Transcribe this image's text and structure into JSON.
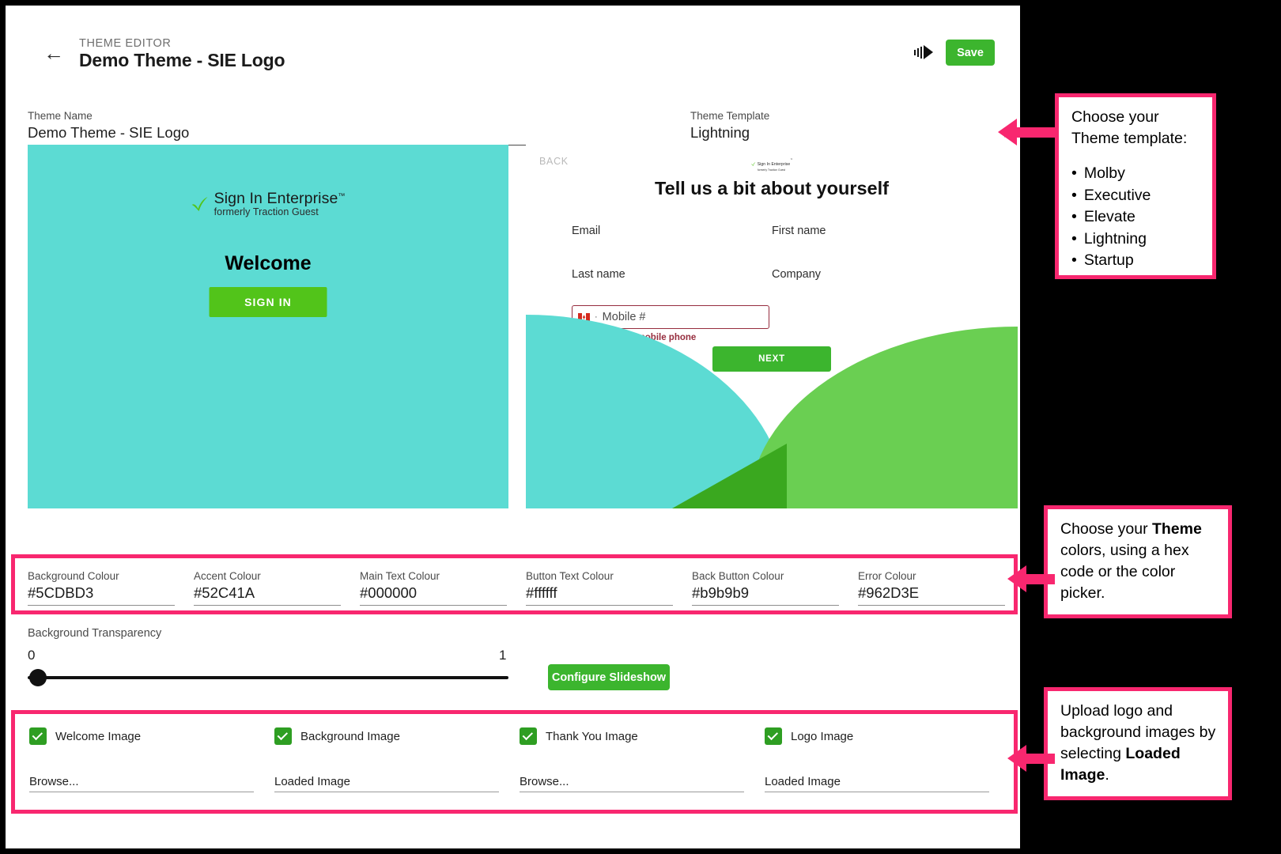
{
  "header": {
    "eyebrow": "THEME EDITOR",
    "title": "Demo Theme - SIE Logo",
    "back_icon": "arrow-left-icon",
    "step_icon": "skip-forward-icon",
    "save_label": "Save",
    "save_color": "#3cb52e"
  },
  "fields": {
    "theme_name": {
      "label": "Theme Name",
      "value": "Demo Theme - SIE Logo"
    },
    "theme_template": {
      "label": "Theme Template",
      "value": "Lightning",
      "options": [
        "Molby",
        "Executive",
        "Elevate",
        "Lightning",
        "Startup"
      ]
    }
  },
  "preview_left": {
    "background_color": "#5CDBD3",
    "logo_name": "Sign In Enterprise",
    "logo_tm": "™",
    "logo_sub": "formerly Traction Guest",
    "welcome": "Welcome",
    "signin_label": "SIGN IN",
    "signin_color": "#52C41A"
  },
  "preview_right": {
    "back_label": "BACK",
    "logo_name": "Sign In Enterprise",
    "logo_tm": "™",
    "logo_sub": "formerly Traction Guest",
    "title": "Tell us a bit about yourself",
    "labels": [
      "Email",
      "First name",
      "Last name",
      "Company"
    ],
    "mobile_placeholder": "Mobile #",
    "mobile_country": "CA",
    "mobile_sep": "·",
    "error_text": "Please enter a mobile phone",
    "next_label": "NEXT",
    "wave_teal": "#5CDBD3",
    "wave_green": "#6ACF52",
    "wave_overlap": "#3aa81f"
  },
  "colours": [
    {
      "label": "Background Colour",
      "value": "#5CDBD3"
    },
    {
      "label": "Accent Colour",
      "value": "#52C41A"
    },
    {
      "label": "Main Text Colour",
      "value": "#000000"
    },
    {
      "label": "Button Text Colour",
      "value": "#ffffff"
    },
    {
      "label": "Back Button Colour",
      "value": "#b9b9b9"
    },
    {
      "label": "Error Colour",
      "value": "#962D3E"
    }
  ],
  "transparency": {
    "label": "Background Transparency",
    "min": "0",
    "max": "1",
    "value": 0,
    "slideshow_label": "Configure Slideshow"
  },
  "images": [
    {
      "checkbox_label": "Welcome Image",
      "checked": true,
      "file_value": "Browse..."
    },
    {
      "checkbox_label": "Background Image",
      "checked": true,
      "file_value": "Loaded Image"
    },
    {
      "checkbox_label": "Thank You Image",
      "checked": true,
      "file_value": "Browse..."
    },
    {
      "checkbox_label": "Logo Image",
      "checked": true,
      "file_value": "Loaded Image"
    }
  ],
  "annotations": {
    "accent_color": "#f8276f",
    "template": {
      "line1": "Choose your",
      "line2": "Theme template:",
      "items": [
        "Molby",
        "Executive",
        "Elevate",
        "Lightning",
        "Startup"
      ]
    },
    "colors": {
      "part1": "Choose your ",
      "bold1": "Theme",
      "part2": " colors, using a hex code or the color picker."
    },
    "images": {
      "part1": "Upload logo and background images by selecting ",
      "bold1": "Loaded Image",
      "part2": "."
    }
  }
}
